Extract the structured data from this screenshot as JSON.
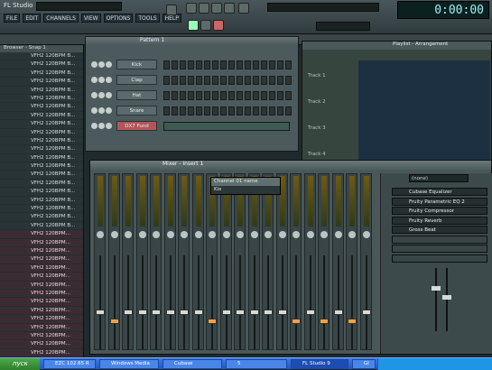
{
  "app": {
    "title": "FL Studio"
  },
  "menu": [
    "FILE",
    "EDIT",
    "CHANNELS",
    "VIEW",
    "OPTIONS",
    "TOOLS",
    "HELP"
  ],
  "transport": {
    "time": "0:00:00"
  },
  "browser": {
    "title": "Browser - Snap 1",
    "items": [
      "VFH2 120BPM B...",
      "VFH2 120BPM B...",
      "VFH2 120BPM B...",
      "VFH2 120BPM B...",
      "VFH2 120BPM B...",
      "VFH2 120BPM B...",
      "VFH2 120BPM B...",
      "VFH2 120BPM B...",
      "VFH2 120BPM B...",
      "VFH2 120BPM B...",
      "VFH2 120BPM B...",
      "VFH2 120BPM B...",
      "VFH2 120BPM B...",
      "VFH2 120BPM B...",
      "VFH2 120BPM B...",
      "VFH2 120BPM B...",
      "VFH2 120BPM B...",
      "VFH2 120BPM B...",
      "VFH2 120BPM B...",
      "VFH2 120BPM B...",
      "VFH2 120BPM B...",
      "VFH2 120BPM...",
      "VFH2 120BPM...",
      "VFH2 120BPM...",
      "VFH2 120BPM...",
      "VFH2 120BPM...",
      "VFH2 120BPM...",
      "VFH2 120BPM...",
      "VFH2 120BPM...",
      "VFH2 120BPM...",
      "VFH2 120BPM...",
      "VFH2 120BPM...",
      "VFH2 120BPM...",
      "VFH2 120BPM...",
      "VFH2 120BPM...",
      "VFH2 120BPM..."
    ]
  },
  "step_sequencer": {
    "title": "Pattern 1",
    "channels": [
      "Kick",
      "Clap",
      "Hat",
      "Snare",
      "DX7 Fund"
    ]
  },
  "playlist": {
    "title": "Playlist - Arrangement",
    "tracks": [
      "Track 1",
      "Track 2",
      "Track 3",
      "Track 4"
    ]
  },
  "mixer": {
    "title": "Mixer - Insert 1",
    "popup": [
      "Channel 01 name",
      "Kix"
    ],
    "fx_select": "(none)",
    "fx_slots": [
      "Cubase Equalizer",
      "Fruity Parametric EQ 2",
      "Fruity Compressor",
      "Fruity Reverb",
      "Gross Beat",
      "",
      "",
      ""
    ]
  },
  "taskbar": {
    "start": "пуск",
    "tasks": [
      "EZC 102.65 R",
      "Windows Media",
      "Cubase",
      "5",
      "FL Studio 9",
      "Gl"
    ]
  }
}
